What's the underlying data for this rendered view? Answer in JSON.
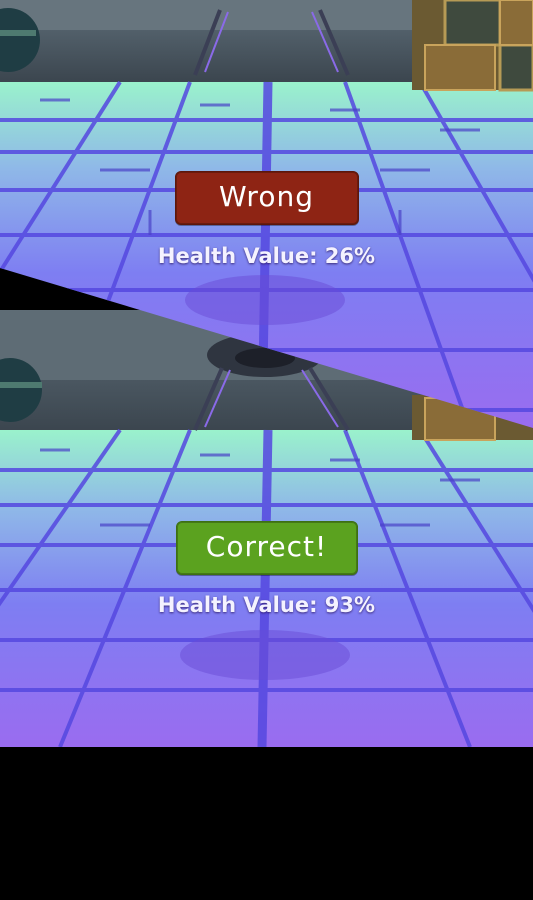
{
  "rounds": [
    {
      "result_label": "Wrong",
      "result_status": "wrong",
      "result_color": "#8e2414",
      "health_text": "Health Value: 26%",
      "health_percent": 26
    },
    {
      "result_label": "Correct!",
      "result_status": "correct",
      "result_color": "#5ba21f",
      "health_text": "Health Value: 93%",
      "health_percent": 93
    }
  ],
  "colors": {
    "floor_purple": "#7b6cf0",
    "floor_green": "#8ff0c8",
    "grid_lines": "#5548e0",
    "wall": "#4a545e"
  },
  "icons": [
    "robot-icon",
    "crate-icon",
    "sphere-icon"
  ]
}
